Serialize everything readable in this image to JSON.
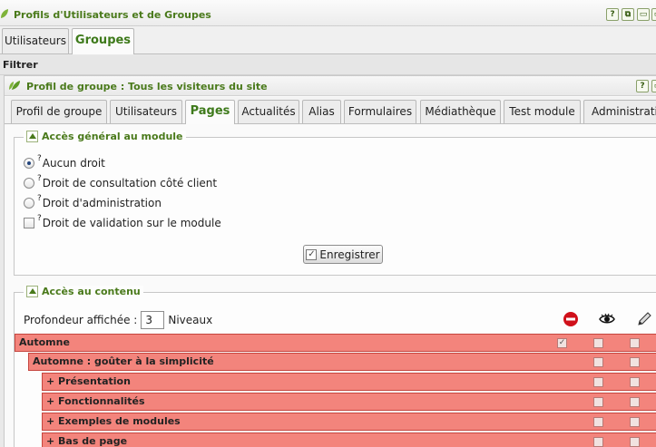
{
  "window": {
    "title": "Profils d'Utilisateurs et de Groupes",
    "help": "?",
    "popout": "⧉",
    "min": "▭",
    "close": "▭"
  },
  "top_tabs": [
    {
      "label": "Utilisateurs"
    },
    {
      "label": "Groupes"
    }
  ],
  "filter": {
    "label": "Filtrer"
  },
  "panel": {
    "title": "Profil de groupe : Tous les visiteurs du site",
    "help": "?",
    "min": "▭"
  },
  "inner_tabs": [
    {
      "label": "Profil de groupe"
    },
    {
      "label": "Utilisateurs"
    },
    {
      "label": "Pages"
    },
    {
      "label": "Actualités"
    },
    {
      "label": "Alias"
    },
    {
      "label": "Formulaires"
    },
    {
      "label": "Médiathèque"
    },
    {
      "label": "Test module"
    },
    {
      "label": "Administration"
    }
  ],
  "general": {
    "legend": "Accès général au module",
    "options": [
      {
        "label": "Aucun droit",
        "checked": true
      },
      {
        "label": "Droit de consultation côté client",
        "checked": false
      },
      {
        "label": "Droit d'administration",
        "checked": false
      }
    ],
    "validation": {
      "label": "Droit de validation sur le module",
      "checked": false
    },
    "help_mark": "?",
    "save_label": "Enregistrer"
  },
  "content": {
    "legend": "Accès au contenu",
    "depth_label": "Profondeur affichée :",
    "depth_value": "3",
    "depth_unit": "Niveaux",
    "column_icons": [
      "no-access-icon",
      "view-icon",
      "edit-icon"
    ],
    "rows": [
      {
        "label": "Automne",
        "level": 0,
        "no_access": true,
        "view": false,
        "edit": false
      },
      {
        "label": "Automne : goûter à la simplicité",
        "level": 1,
        "no_access": false,
        "view": false,
        "edit": false
      },
      {
        "label": "+ Présentation",
        "level": 2,
        "no_access": false,
        "view": false,
        "edit": false
      },
      {
        "label": "+ Fonctionnalités",
        "level": 2,
        "no_access": false,
        "view": false,
        "edit": false
      },
      {
        "label": "+ Exemples de modules",
        "level": 2,
        "no_access": false,
        "view": false,
        "edit": false
      },
      {
        "label": "+ Bas de page",
        "level": 2,
        "no_access": false,
        "view": false,
        "edit": false
      }
    ]
  },
  "colors": {
    "accent": "#4a7a1b",
    "row_bg": "#f3847c",
    "row_border": "#c5453e"
  }
}
